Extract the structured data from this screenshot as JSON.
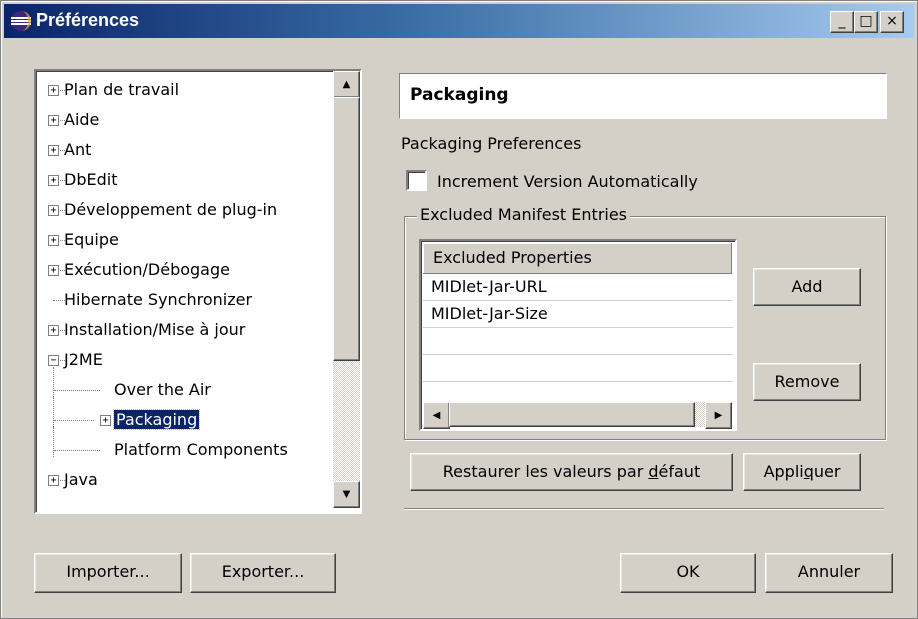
{
  "window": {
    "title": "Préférences",
    "controls": {
      "minimize": "_",
      "maximize": "□",
      "close": "×"
    }
  },
  "tree": {
    "items": [
      {
        "label": "Plan de travail",
        "expander": "+"
      },
      {
        "label": "Aide",
        "expander": "+"
      },
      {
        "label": "Ant",
        "expander": "+"
      },
      {
        "label": "DbEdit",
        "expander": "+"
      },
      {
        "label": "Développement de plug-in",
        "expander": "+"
      },
      {
        "label": "Equipe",
        "expander": "+"
      },
      {
        "label": "Exécution/Débogage",
        "expander": "+"
      },
      {
        "label": "Hibernate Synchronizer",
        "expander": ""
      },
      {
        "label": "Installation/Mise à jour",
        "expander": "+"
      },
      {
        "label": "J2ME",
        "expander": "−"
      },
      {
        "label": "Over the Air",
        "expander": ""
      },
      {
        "label": "Packaging",
        "expander": "+"
      },
      {
        "label": "Platform Components",
        "expander": ""
      },
      {
        "label": "Java",
        "expander": "+"
      }
    ],
    "selected": "Packaging"
  },
  "page": {
    "title": "Packaging",
    "section_label": "Packaging Preferences",
    "checkbox_label": "Increment Version Automatically",
    "checkbox_checked": false,
    "group_label": "Excluded Manifest Entries",
    "table_header": "Excluded Properties",
    "table_rows": [
      "MIDlet-Jar-URL",
      "MIDlet-Jar-Size"
    ],
    "add_button": "Add",
    "remove_button": "Remove",
    "restore_prefix": "Restaurer les valeurs par ",
    "restore_mnemonic": "d",
    "restore_suffix": "éfaut",
    "apply_prefix": "Appli",
    "apply_mnemonic": "q",
    "apply_suffix": "uer"
  },
  "footer": {
    "import_button": "Importer...",
    "export_button": "Exporter...",
    "ok_button": "OK",
    "cancel_button": "Annuler"
  }
}
